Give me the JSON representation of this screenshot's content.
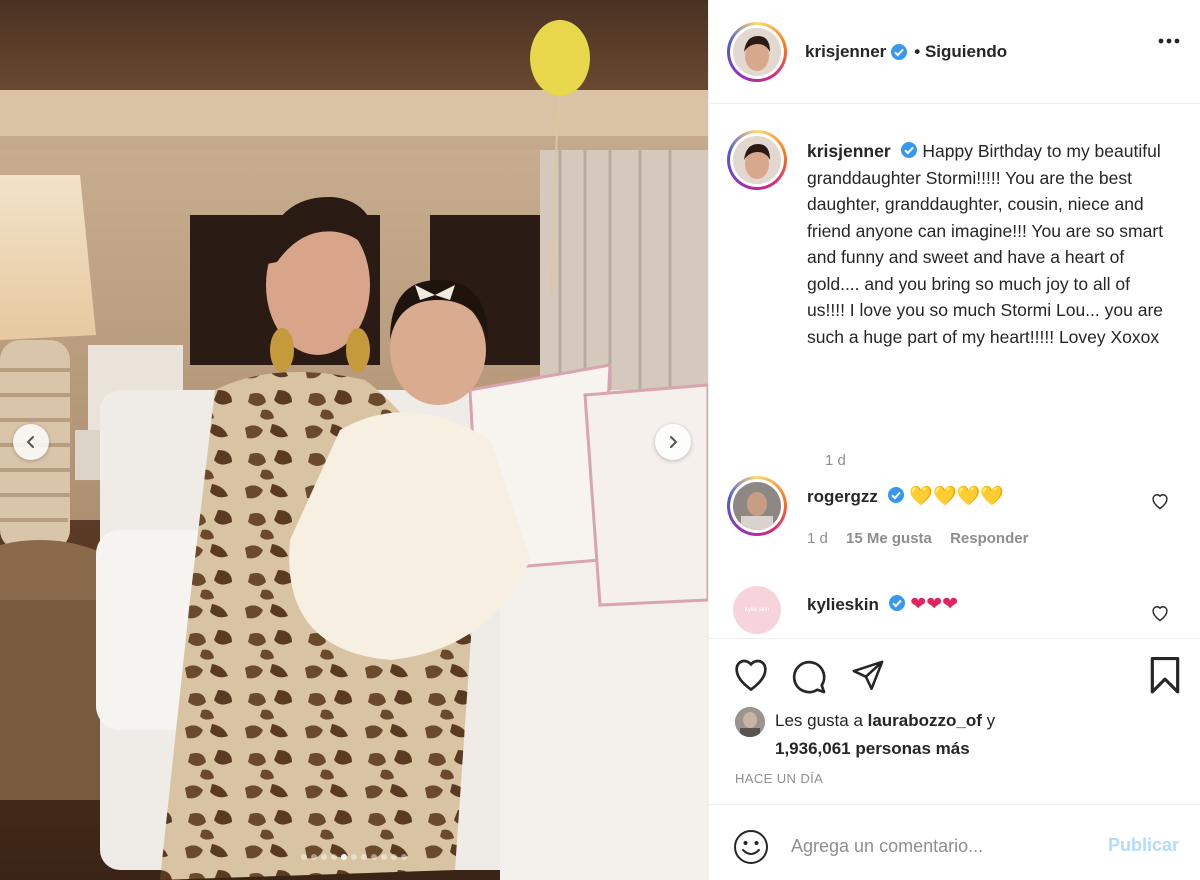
{
  "carousel": {
    "prev_icon": "chevron-left-icon",
    "next_icon": "chevron-right-icon",
    "total_slides": 11,
    "active_slide": 5
  },
  "post": {
    "author": "krisjenner",
    "follow_state": "• Siguiendo",
    "more_icon": "more-horizontal-icon",
    "caption": "Happy Birthday to my beautiful granddaughter Stormi!!!!! You are the best daughter, granddaughter, cousin, niece and friend anyone can imagine!!! You are so smart and funny and sweet and have a heart of gold.... and you bring so much joy to all of us!!!! I love you so much Stormi Lou... you are such a huge part of my heart!!!!! Lovey Xoxox",
    "caption_time": "1 d"
  },
  "comments": [
    {
      "user": "rogergzz",
      "emojis": "💛💛💛💛",
      "time": "1 d",
      "likes": "15 Me gusta",
      "reply": "Responder"
    },
    {
      "user": "kylieskin",
      "emojis": "❤❤❤",
      "avatar_text": "kylie skin"
    }
  ],
  "actions": {
    "like_icon": "heart-icon",
    "comment_icon": "comment-icon",
    "share_icon": "send-icon",
    "save_icon": "bookmark-icon"
  },
  "likes": {
    "prefix": "Les gusta a ",
    "user": "laurabozzo_of",
    "suffix": " y",
    "count_text": "1,936,061 personas más"
  },
  "date_label": "HACE UN DÍA",
  "comment_input": {
    "placeholder": "Agrega un comentario...",
    "post_label": "Publicar",
    "emoji_icon": "smiley-icon"
  },
  "colors": {
    "accent_disabled": "#b3dbff",
    "verified": "#3897f0",
    "secondary_text": "#8e8e8e"
  }
}
